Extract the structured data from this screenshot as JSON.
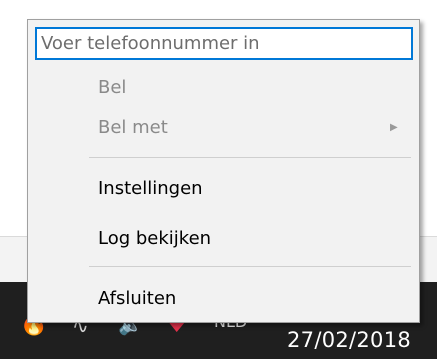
{
  "menu": {
    "phone_placeholder": "Voer telefoonnummer in",
    "call": "Bel",
    "call_with": "Bel met",
    "settings": "Instellingen",
    "view_log": "Log bekijken",
    "exit": "Afsluiten",
    "submenu_arrow": "▶"
  },
  "taskbar": {
    "language": "NLD",
    "date": "27/02/2018",
    "icons": [
      "flame-icon",
      "network-icon",
      "volume-icon",
      "shield-icon"
    ]
  },
  "colors": {
    "input_border": "#0078d7",
    "taskbar": "#1f1f1f",
    "disabled_text": "#8a8a8a"
  }
}
